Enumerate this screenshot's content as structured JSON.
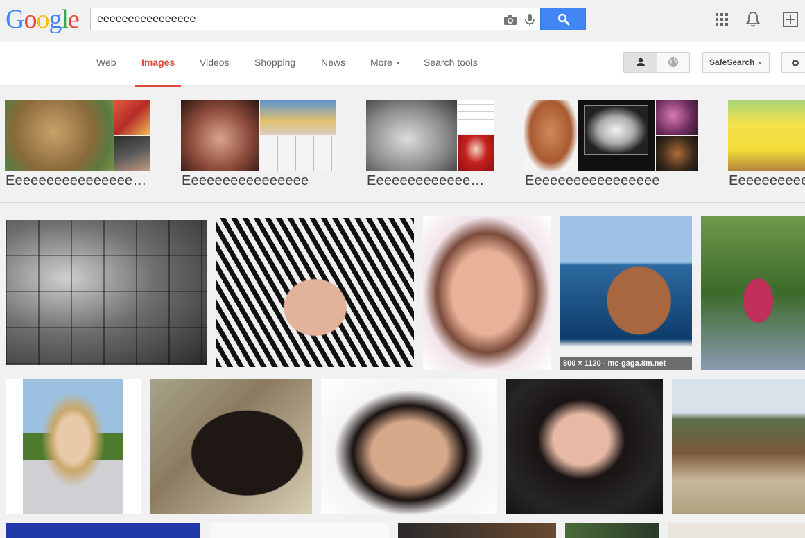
{
  "logo": {
    "letters": [
      "G",
      "o",
      "o",
      "g",
      "l",
      "e"
    ],
    "colors": [
      "#4285f4",
      "#ea4335",
      "#fbbc05",
      "#4285f4",
      "#34a853",
      "#ea4335"
    ]
  },
  "search": {
    "query": "eeeeeeeeeeeeeeee"
  },
  "header_icons": [
    "camera-icon",
    "microphone-icon",
    "search-icon",
    "apps-grid-icon",
    "notifications-bell-icon",
    "share-plus-icon"
  ],
  "nav": {
    "tabs": [
      {
        "label": "Web",
        "active": false
      },
      {
        "label": "Images",
        "active": true
      },
      {
        "label": "Videos",
        "active": false
      },
      {
        "label": "Shopping",
        "active": false
      },
      {
        "label": "News",
        "active": false
      },
      {
        "label": "More",
        "active": false
      },
      {
        "label": "Search tools",
        "active": false
      }
    ],
    "safesearch_label": "SafeSearch"
  },
  "colors": {
    "active_tab": "#dd4b39",
    "search_button": "#4285f4",
    "page_bg": "#f1f1f1"
  },
  "related": [
    {
      "label": "Eeeeeeeeeeeeeeee…"
    },
    {
      "label": "Eeeeeeeeeeeeeeee"
    },
    {
      "label": "Eeeeeeeeeeeee…"
    },
    {
      "label": "Eeeeeeeeeeeeeeeee"
    },
    {
      "label": "Eeeeeeeeeeee"
    }
  ],
  "results": {
    "hover_caption": "800 × 1120 - mc-gaga.8m.net"
  }
}
